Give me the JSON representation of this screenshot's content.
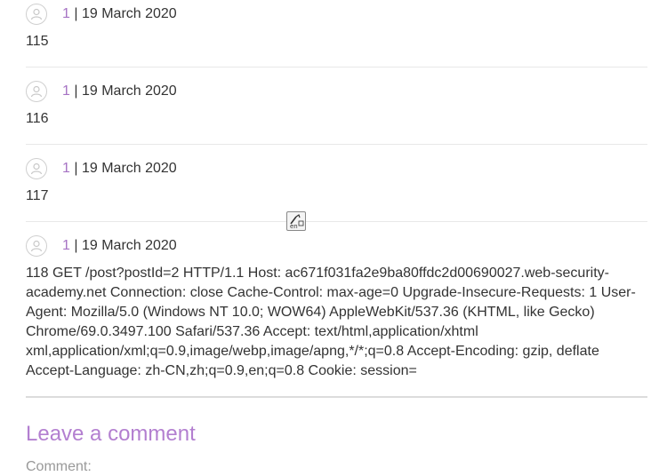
{
  "comments": [
    {
      "author": "1",
      "separator": "|",
      "date": "19 March 2020",
      "text": "115"
    },
    {
      "author": "1",
      "separator": "|",
      "date": "19 March 2020",
      "text": "116"
    },
    {
      "author": "1",
      "separator": "|",
      "date": "19 March 2020",
      "text": "117"
    },
    {
      "author": "1",
      "separator": "|",
      "date": "19 March 2020",
      "text": "118 GET /post?postId=2 HTTP/1.1 Host: ac671f031fa2e9ba80ffdc2d00690027.web-security-academy.net Connection: close Cache-Control: max-age=0 Upgrade-Insecure-Requests: 1 User-Agent: Mozilla/5.0 (Windows NT 10.0; WOW64) AppleWebKit/537.36 (KHTML, like Gecko) Chrome/69.0.3497.100 Safari/537.36 Accept: text/html,application/xhtml xml,application/xml;q=0.9,image/webp,image/apng,*/*;q=0.8 Accept-Encoding: gzip, deflate Accept-Language: zh-CN,zh;q=0.9,en;q=0.8 Cookie: session="
    }
  ],
  "leave_comment": {
    "title": "Leave a comment",
    "comment_label": "Comment:"
  },
  "icons": {
    "avatar": "user-avatar-icon",
    "floating": "translate-icon"
  },
  "colors": {
    "accent": "#a673c4",
    "title": "#b37fd0",
    "text": "#333333",
    "muted": "#999999"
  }
}
